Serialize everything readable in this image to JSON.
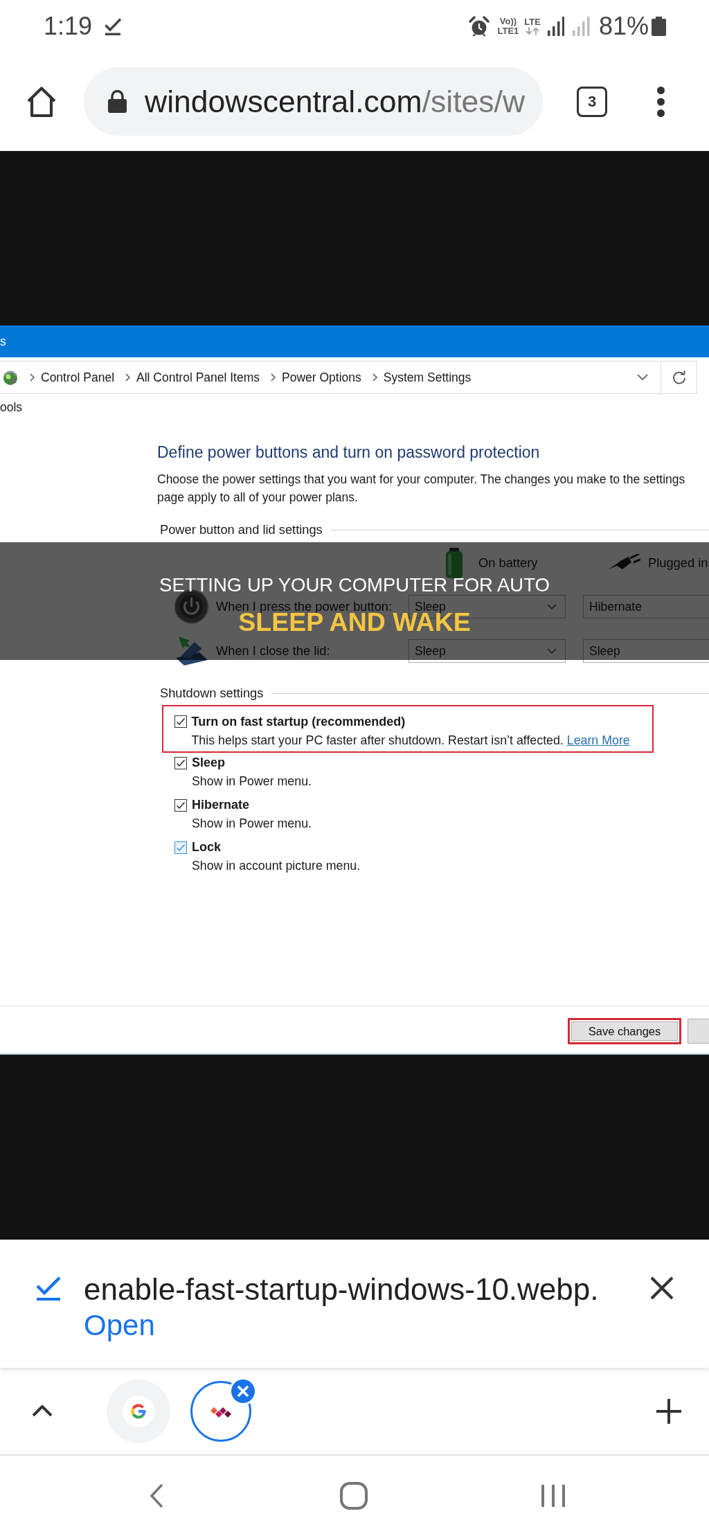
{
  "status_bar": {
    "time": "1:19",
    "volte": "Vo))",
    "volte_line": "LTE1",
    "network": "LTE",
    "battery": "81%"
  },
  "browser_toolbar": {
    "url_host": "windowscentral.com",
    "url_path": "/sites/w",
    "tab_count": "3"
  },
  "article_image": {
    "window": {
      "title": "s",
      "breadcrumb": [
        "Control Panel",
        "All Control Panel Items",
        "Power Options",
        "System Settings"
      ],
      "menu": [
        "ools"
      ],
      "heading": "Define power buttons and turn on password protection",
      "description": "Choose the power settings that you want for your computer. The changes you make to the settings page apply to all of your power plans.",
      "power_settings": {
        "title": "Power button and lid settings",
        "columns": [
          {
            "kind": "battery",
            "label": "On battery"
          },
          {
            "kind": "plugged",
            "label": "Plugged in"
          }
        ],
        "rows": [
          {
            "kind": "power",
            "label": "When I press the power button:",
            "values": [
              "Sleep",
              "Hibernate"
            ]
          },
          {
            "kind": "lid",
            "label": "When I close the lid:",
            "values": [
              "Sleep",
              "Sleep"
            ]
          }
        ]
      },
      "shutdown_settings": {
        "title": "Shutdown settings",
        "options": [
          {
            "label": "Turn on fast startup (recommended)",
            "description": "This helps start your PC faster after shutdown. Restart isn’t affected.",
            "link": "Learn More",
            "checked": true,
            "hovered": false,
            "highlighted": true
          },
          {
            "label": "Sleep",
            "description": "Show in Power menu.",
            "checked": true,
            "hovered": false,
            "highlighted": false
          },
          {
            "label": "Hibernate",
            "description": "Show in Power menu.",
            "checked": true,
            "hovered": false,
            "highlighted": false
          },
          {
            "label": "Lock",
            "description": "Show in account picture menu.",
            "checked": true,
            "hovered": true,
            "highlighted": false
          }
        ]
      },
      "buttons": [
        {
          "label": "Save changes",
          "highlighted": true
        }
      ]
    },
    "headline": [
      {
        "text": "SETTING UP YOUR COMPUTER FOR AUTO",
        "kind": "plain"
      },
      {
        "text": "SLEEP AND WAKE",
        "kind": "accent"
      }
    ]
  },
  "download_bar": {
    "filename": "enable-fast-startup-windows-10.webp.",
    "action": "Open"
  },
  "tab_strip": {
    "tabs": [
      {
        "kind": "google",
        "selected": false
      },
      {
        "kind": "site",
        "selected": true
      }
    ]
  }
}
